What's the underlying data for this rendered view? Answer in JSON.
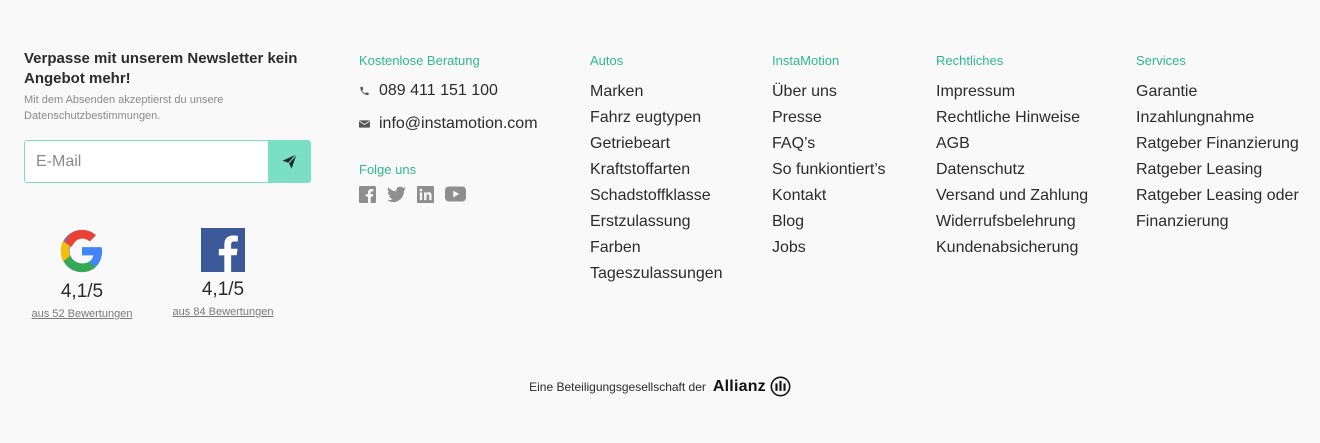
{
  "newsletter": {
    "title": "Verpasse mit unserem Newsletter kein Angebot mehr!",
    "note": "Mit dem Absenden akzeptierst du unsere Datenschutzbestimmungen.",
    "placeholder": "E-Mail"
  },
  "ratings": [
    {
      "source": "google-icon",
      "score": "4,1/5",
      "count": "aus 52 Bewertungen"
    },
    {
      "source": "facebook-icon",
      "score": "4,1/5",
      "count": "aus 84 Bewertungen"
    }
  ],
  "contact": {
    "heading": "Kostenlose Beratung",
    "phone": "089 411 151 100",
    "email": "info@instamotion.com",
    "follow_heading": "Folge uns",
    "social_icons": [
      "facebook-icon",
      "twitter-icon",
      "linkedin-icon",
      "youtube-icon"
    ]
  },
  "columns": [
    {
      "heading": "Autos",
      "items": [
        "Marken",
        "Fahrz eugtypen",
        "Getriebeart",
        "Kraftstoffarten",
        "Schadstoffklasse",
        "Erstzulassung",
        "Farben",
        "Tageszulassungen"
      ]
    },
    {
      "heading": "InstaMotion",
      "items": [
        "Über uns",
        "Presse",
        "FAQ’s",
        "So funkiontiert’s",
        "Kontakt",
        "Blog",
        "Jobs"
      ]
    },
    {
      "heading": "Rechtliches",
      "items": [
        "Impressum",
        "Rechtliche Hinweise",
        "AGB",
        "Datenschutz",
        "Versand und Zahlung",
        "Widerrufsbelehrung",
        "Kundenabsicherung"
      ]
    },
    {
      "heading": "Services",
      "items": [
        "Garantie",
        "Inzahlungnahme",
        "Ratgeber Finanzierung",
        "Ratgeber Leasing",
        "Ratgeber Leasing oder",
        "Finanzierung"
      ]
    }
  ],
  "footer": {
    "text": "Eine Beteiligungsgesellschaft der",
    "brand": "Allianz"
  },
  "colors": {
    "accent": "#2eb891",
    "button": "#7adfc3",
    "background": "#f9f9f9"
  }
}
